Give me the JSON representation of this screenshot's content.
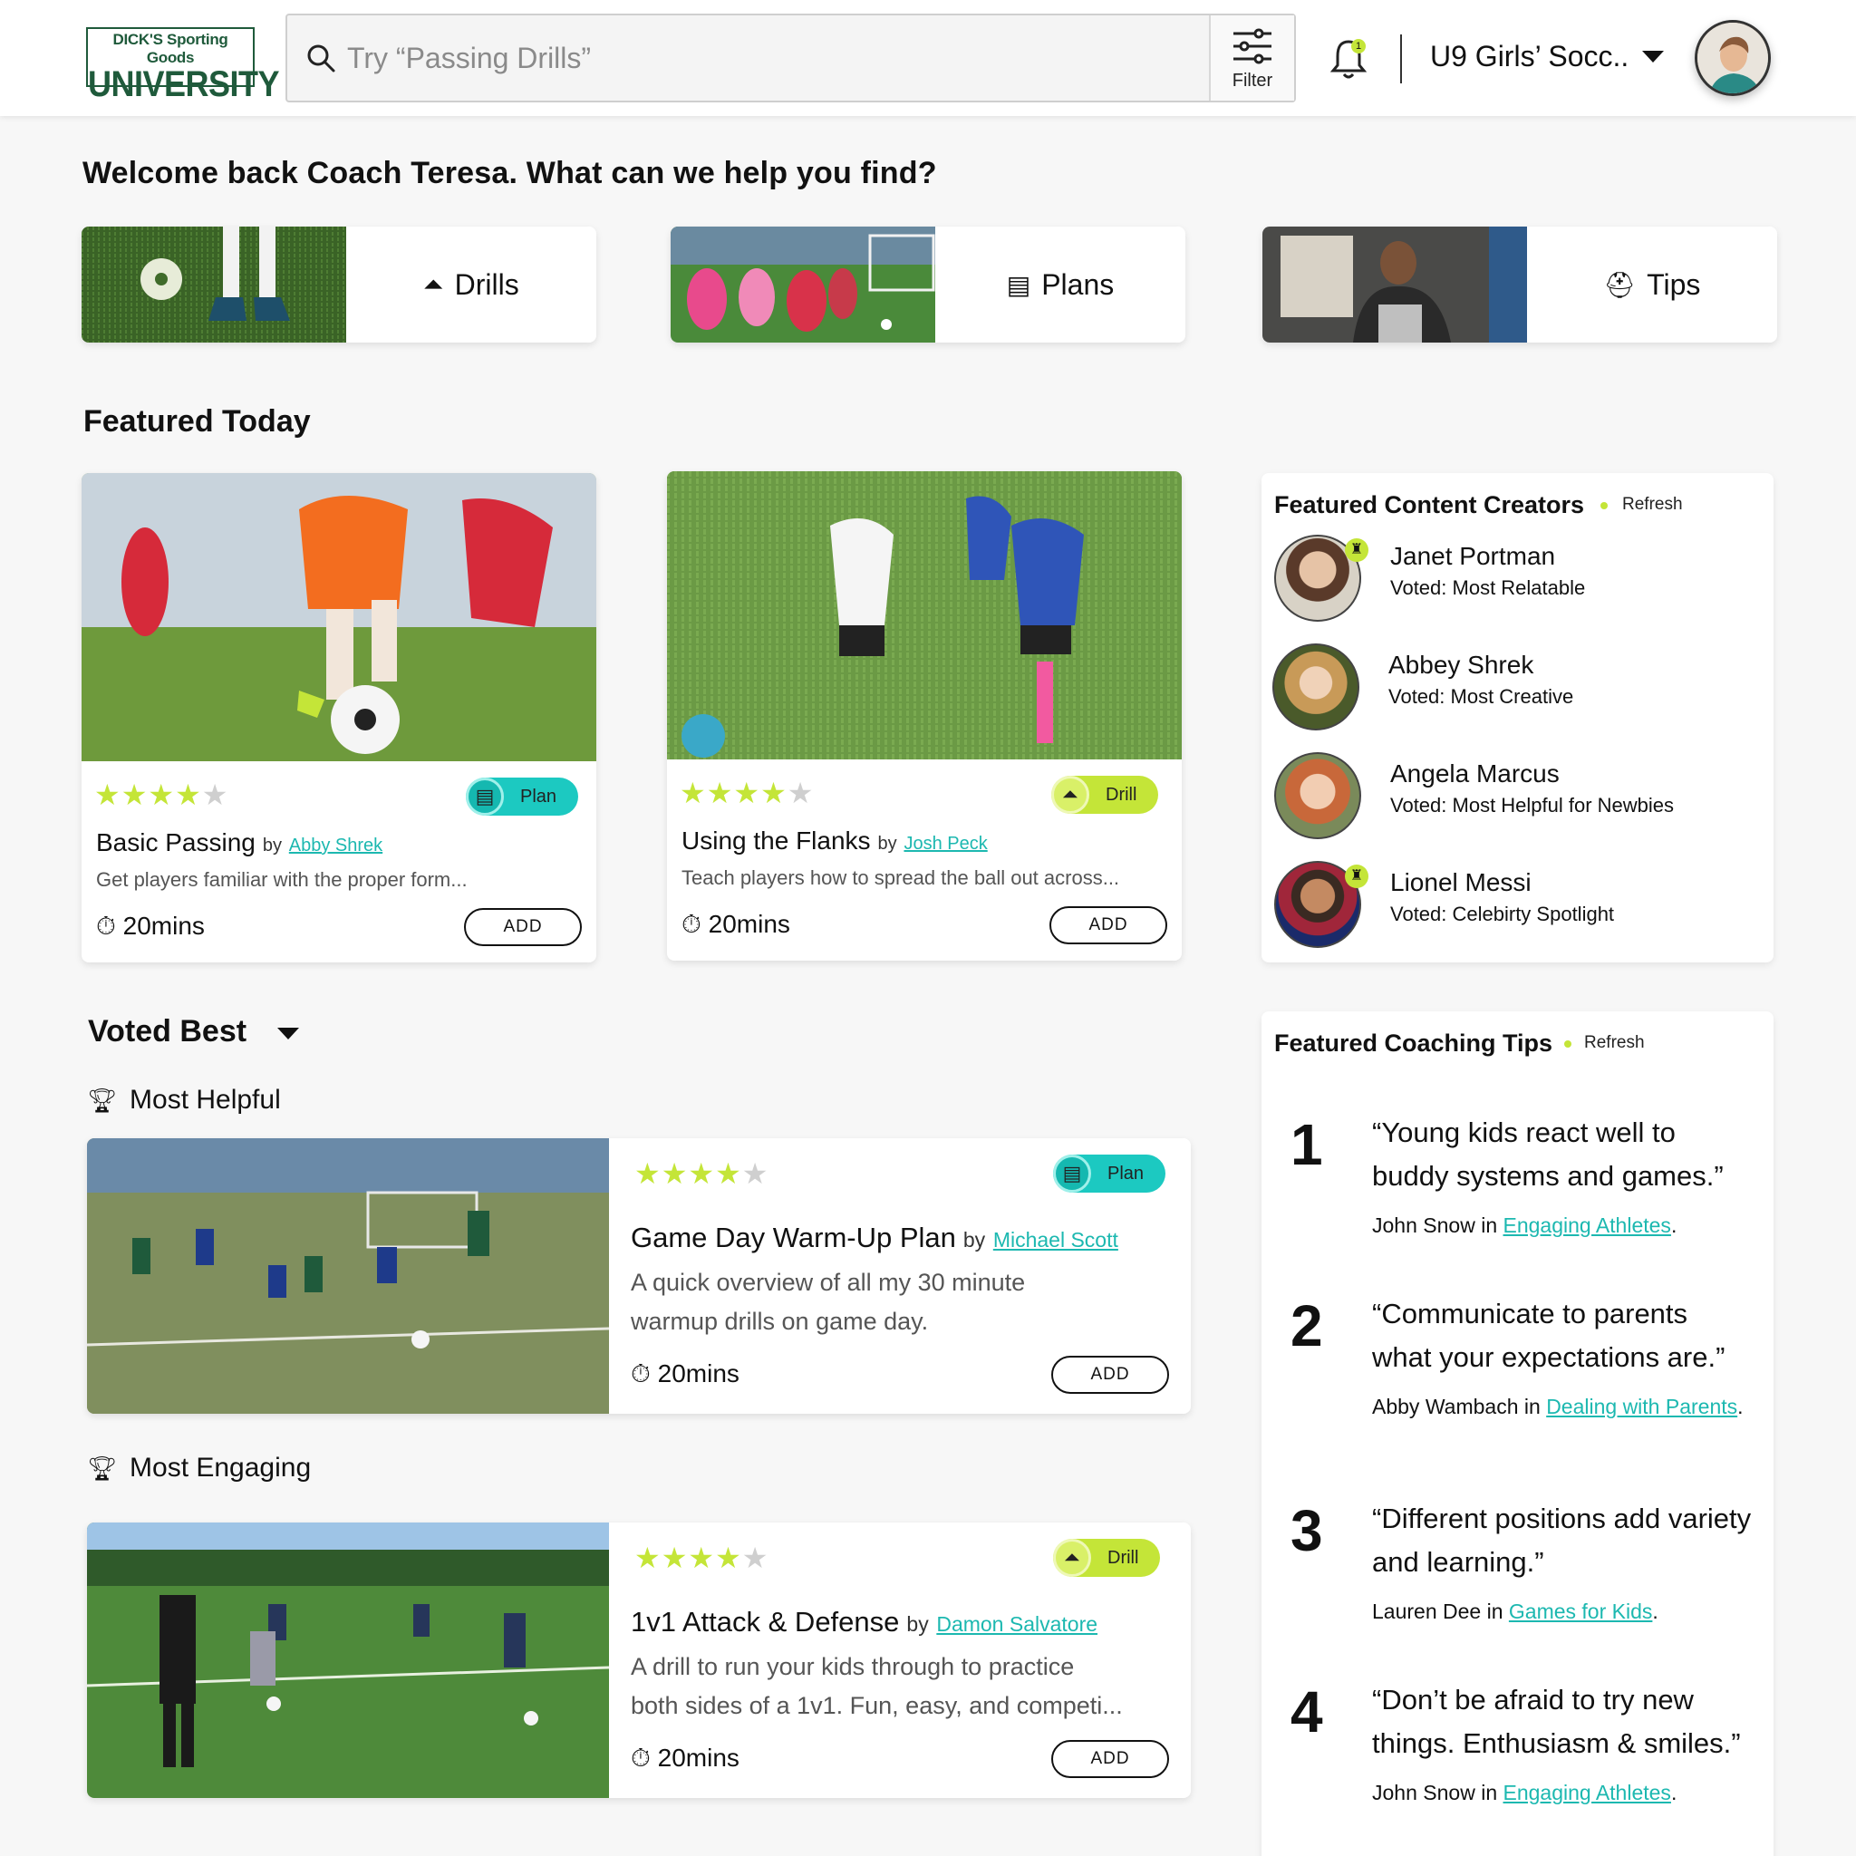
{
  "header": {
    "logo_top": "DICK'S Sporting Goods",
    "logo_bottom": "UNIVERSITY",
    "search_placeholder": "Try “Passing Drills”",
    "filter_label": "Filter",
    "notification_count": "1",
    "team_name": "U9 Girls’ Socc.."
  },
  "welcome": "Welcome back Coach Teresa. What can we help you find?",
  "categories": [
    {
      "label": "Drills",
      "icon": "cone-icon"
    },
    {
      "label": "Plans",
      "icon": "document-icon"
    },
    {
      "label": "Tips",
      "icon": "whistle-icon"
    }
  ],
  "featured": {
    "title": "Featured Today",
    "items": [
      {
        "rating": 4,
        "type": "Plan",
        "title": "Basic Passing",
        "by": "by",
        "author": "Abby Shrek",
        "desc": "Get players familiar with the proper form...",
        "duration": "20mins",
        "add": "ADD"
      },
      {
        "rating": 4,
        "type": "Drill",
        "title": "Using the Flanks",
        "by": "by",
        "author": "Josh Peck",
        "desc": "Teach players how to spread the ball out across...",
        "duration": "20mins",
        "add": "ADD"
      }
    ]
  },
  "voted": {
    "title": "Voted Best",
    "groups": [
      {
        "award": "Most Helpful",
        "rating": 4,
        "type": "Plan",
        "title": "Game Day Warm-Up Plan",
        "by": "by",
        "author": "Michael Scott",
        "desc1": "A quick overview of all my 30 minute",
        "desc2": "warmup drills on game day.",
        "duration": "20mins",
        "add": "ADD"
      },
      {
        "award": "Most Engaging",
        "rating": 4,
        "type": "Drill",
        "title": "1v1 Attack & Defense",
        "by": "by",
        "author": "Damon Salvatore",
        "desc1": "A drill to run your kids through to practice",
        "desc2": "both sides of a 1v1. Fun, easy, and competi...",
        "duration": "20mins",
        "add": "ADD"
      }
    ]
  },
  "creators": {
    "title": "Featured Content Creators",
    "refresh": "Refresh",
    "items": [
      {
        "name": "Janet Portman",
        "vote": "Voted: Most Relatable",
        "badge": true
      },
      {
        "name": "Abbey Shrek",
        "vote": "Voted: Most Creative",
        "badge": false
      },
      {
        "name": "Angela Marcus",
        "vote": "Voted: Most Helpful for Newbies",
        "badge": false
      },
      {
        "name": "Lionel Messi",
        "vote": "Voted: Celebirty Spotlight",
        "badge": true
      }
    ]
  },
  "tips": {
    "title": "Featured Coaching Tips",
    "refresh": "Refresh",
    "items": [
      {
        "num": "1",
        "quote": "“Young kids react well to buddy systems and games.”",
        "author": "John Snow",
        "in": "in",
        "topic": "Engaging Athletes",
        "end": "."
      },
      {
        "num": "2",
        "quote": "“Communicate to parents what your expectations are.”",
        "author": "Abby Wambach",
        "in": "in",
        "topic": "Dealing with Parents",
        "end": "."
      },
      {
        "num": "3",
        "quote": "“Different positions add variety and learning.”",
        "author": "Lauren Dee",
        "in": "in",
        "topic": "Games for Kids",
        "end": "."
      },
      {
        "num": "4",
        "quote": "“Don’t be afraid to try new things. Enthusiasm & smiles.”",
        "author": "John Snow",
        "in": "in",
        "topic": "Engaging Athletes",
        "end": "."
      }
    ]
  },
  "colors": {
    "accent_lime": "#c4e538",
    "accent_teal": "#1cc9c1",
    "brand_green": "#1f5a3b"
  }
}
